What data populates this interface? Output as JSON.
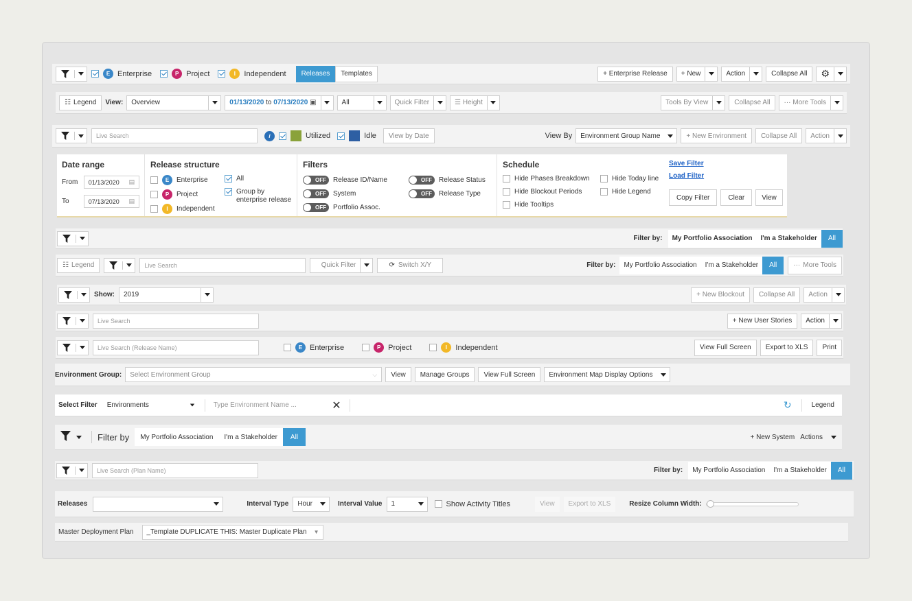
{
  "row1": {
    "enterprise": "Enterprise",
    "project": "Project",
    "independent": "Independent",
    "tabs": [
      "Releases",
      "Templates"
    ],
    "new_ent_release": "+ Enterprise Release",
    "new": "+ New",
    "action": "Action",
    "collapse_all": "Collapse All"
  },
  "row2": {
    "legend": "Legend",
    "view_label": "View:",
    "view_value": "Overview",
    "date_from": "01/13/2020",
    "date_to_word": "to",
    "date_to": "07/13/2020",
    "all": "All",
    "quick_filter": "Quick Filter",
    "height": "Height",
    "tools_by_view": "Tools By View",
    "collapse_all": "Collapse All",
    "more_tools": "More Tools"
  },
  "row3": {
    "search_placeholder": "Live Search",
    "utilized": "Utilized",
    "idle": "Idle",
    "view_by_date": "View by Date",
    "view_by": "View By",
    "view_by_value": "Environment Group Name",
    "new_env": "+ New Environment",
    "collapse_all": "Collapse All",
    "action": "Action"
  },
  "panel": {
    "date_range": "Date range",
    "from": "From",
    "from_value": "01/13/2020",
    "to": "To",
    "to_value": "07/13/2020",
    "release_structure": "Release structure",
    "enterprise": "Enterprise",
    "project": "Project",
    "independent": "Independent",
    "all": "All",
    "group_by": "Group by",
    "group_by2": "enterprise release",
    "filters": "Filters",
    "toggle_off": "OFF",
    "f1": "Release ID/Name",
    "f2": "System",
    "f3": "Portfolio Assoc.",
    "f4": "Release Status",
    "f5": "Release Type",
    "schedule": "Schedule",
    "s1": "Hide Phases Breakdown",
    "s2": "Hide Blockout Periods",
    "s3": "Hide Tooltips",
    "s4": "Hide Today line",
    "s5": "Hide Legend",
    "save_filter": "Save Filter",
    "load_filter": "Load Filter",
    "copy_filter": "Copy Filter",
    "clear": "Clear",
    "view": "View"
  },
  "row5": {
    "filter_by": "Filter by:",
    "my_portfolio": "My Portfolio Association",
    "stakeholder": "I'm a Stakeholder",
    "all": "All"
  },
  "row6": {
    "legend": "Legend",
    "search_placeholder": "Live Search",
    "quick_filter": "Quick Filter",
    "switch": "Switch X/Y",
    "filter_by": "Filter by:",
    "my_portfolio": "My Portfolio Association",
    "stakeholder": "I'm a Stakeholder",
    "all": "All",
    "more_tools": "More Tools"
  },
  "row7": {
    "show": "Show:",
    "show_value": "2019",
    "new_blockout": "+ New Blockout",
    "collapse_all": "Collapse All",
    "action": "Action"
  },
  "row8": {
    "search_placeholder": "Live Search",
    "new_stories": "+ New User Stories",
    "action": "Action"
  },
  "row9": {
    "search_placeholder": "Live Search (Release Name)",
    "enterprise": "Enterprise",
    "project": "Project",
    "independent": "Independent",
    "full_screen": "View Full Screen",
    "export": "Export to XLS",
    "print": "Print"
  },
  "row10": {
    "label": "Environment Group:",
    "placeholder": "Select Environment Group",
    "view": "View",
    "manage": "Manage Groups",
    "full_screen": "View Full Screen",
    "map_options": "Environment Map Display Options"
  },
  "row11": {
    "label": "Select Filter",
    "value": "Environments",
    "placeholder": "Type Environment Name ...",
    "legend": "Legend"
  },
  "row12": {
    "filter_by": "Filter by",
    "my_portfolio": "My Portfolio Association",
    "stakeholder": "I'm a Stakeholder",
    "all": "All",
    "new_system": "+ New System",
    "actions": "Actions"
  },
  "row13": {
    "search_placeholder": "Live Search (Plan Name)",
    "filter_by": "Filter by:",
    "my_portfolio": "My Portfolio Association",
    "stakeholder": "I'm a Stakeholder",
    "all": "All"
  },
  "row14": {
    "releases": "Releases",
    "interval_type": "Interval Type",
    "interval_type_value": "Hour",
    "interval_value": "Interval Value",
    "interval_value_value": "1",
    "show_titles": "Show Activity Titles",
    "view": "View",
    "export": "Export to XLS",
    "resize": "Resize Column Width:"
  },
  "row15": {
    "label": "Master Deployment Plan",
    "value": "_Template DUPLICATE THIS: Master Duplicate Plan"
  },
  "icons": {
    "filter": "funnel-icon",
    "legend": "legend-icon",
    "calendar": "calendar-icon",
    "info": "info-icon",
    "gear": "gear-icon",
    "refresh": "refresh-icon",
    "close": "close-icon",
    "switch": "switch-icon",
    "height": "height-icon",
    "dots": "dots-icon"
  },
  "colors": {
    "accent": "#3d9ad1",
    "utilized": "#8aa23a",
    "idle": "#2e5fa3",
    "enterprise": "#3a87c8",
    "project": "#c7256a",
    "independent": "#f2b827"
  }
}
